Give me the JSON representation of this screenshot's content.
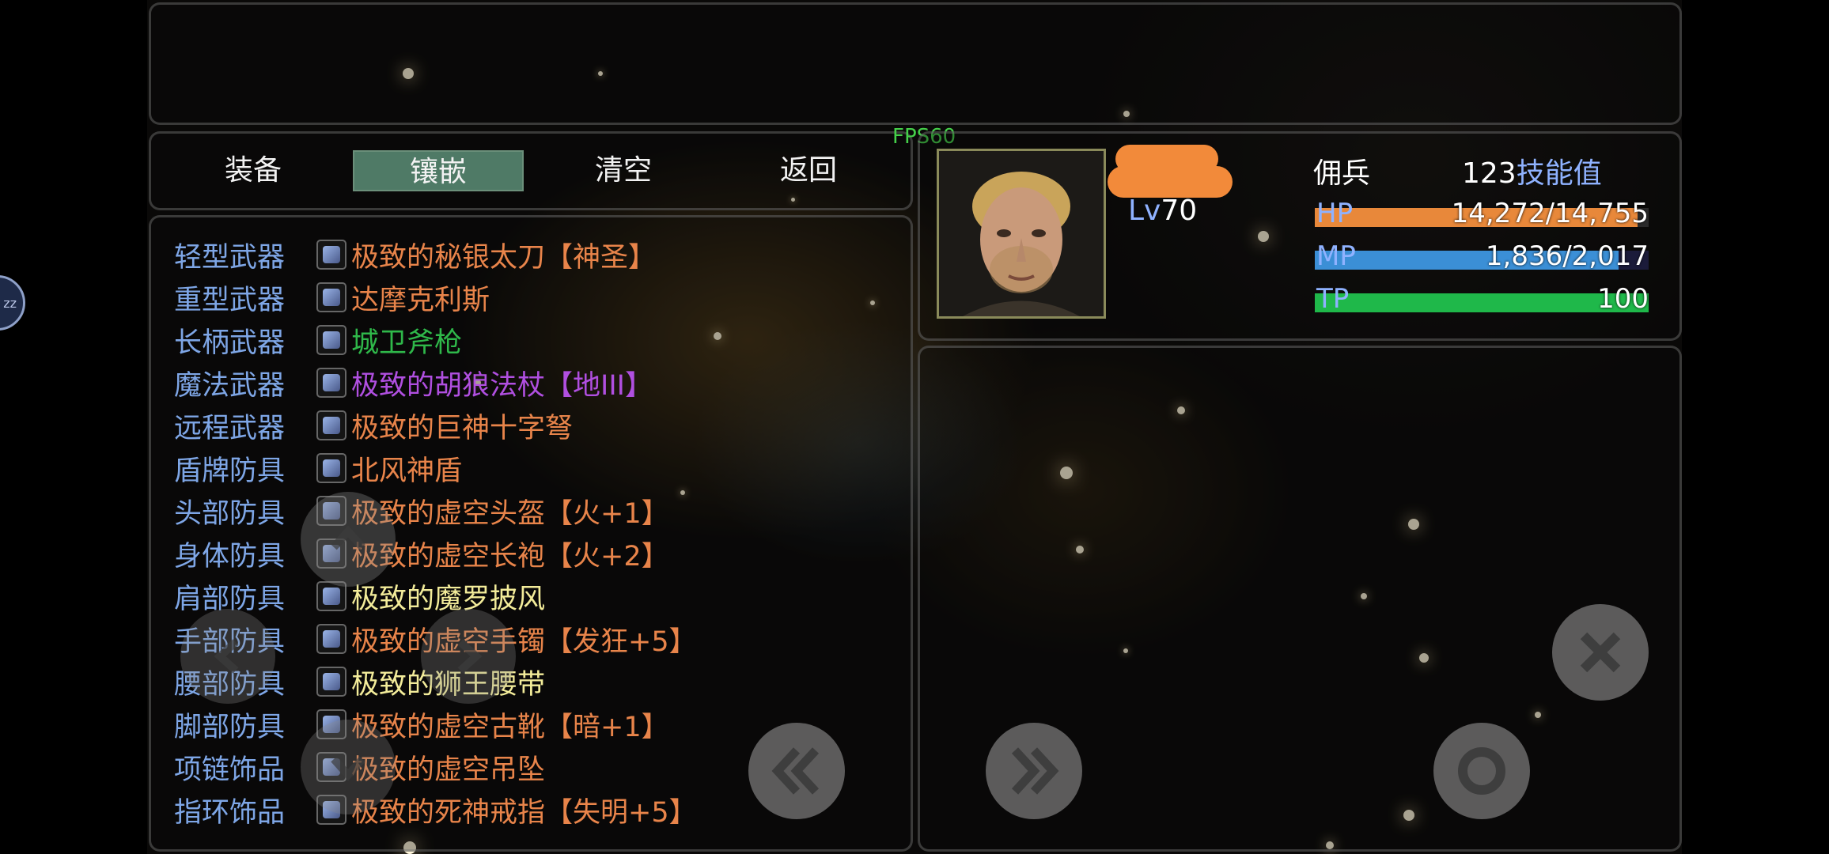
{
  "fps": "FPS60",
  "tabs": [
    {
      "label": "装备",
      "active": false
    },
    {
      "label": "镶嵌",
      "active": true
    },
    {
      "label": "清空",
      "active": false
    },
    {
      "label": "返回",
      "active": false
    }
  ],
  "equipment": [
    {
      "slot": "轻型武器",
      "item": "极致的秘银太刀【神圣】",
      "color": "#e8844a",
      "icon": "blade-icon"
    },
    {
      "slot": "重型武器",
      "item": "达摩克利斯",
      "color": "#e8844a",
      "icon": "greatsword-icon"
    },
    {
      "slot": "长柄武器",
      "item": "城卫斧枪",
      "color": "#2fb84a",
      "icon": "halberd-icon"
    },
    {
      "slot": "魔法武器",
      "item": "极致的胡狼法杖【地III】",
      "color": "#b04fe0",
      "icon": "staff-icon"
    },
    {
      "slot": "远程武器",
      "item": "极致的巨神十字弩",
      "color": "#e8844a",
      "icon": "crossbow-icon"
    },
    {
      "slot": "盾牌防具",
      "item": "北风神盾",
      "color": "#e8844a",
      "icon": "shield-icon"
    },
    {
      "slot": "头部防具",
      "item": "极致的虚空头盔【火+1】",
      "color": "#e8844a",
      "icon": "helmet-icon"
    },
    {
      "slot": "身体防具",
      "item": "极致的虚空长袍【火+2】",
      "color": "#e8844a",
      "icon": "robe-icon"
    },
    {
      "slot": "肩部防具",
      "item": "极致的魔罗披风",
      "color": "#f3ec9a",
      "icon": "cloak-icon"
    },
    {
      "slot": "手部防具",
      "item": "极致的虚空手镯【发狂+5】",
      "color": "#e8844a",
      "icon": "bracelet-icon"
    },
    {
      "slot": "腰部防具",
      "item": "极致的狮王腰带",
      "color": "#f3ec9a",
      "icon": "belt-icon"
    },
    {
      "slot": "脚部防具",
      "item": "极致的虚空古靴【暗+1】",
      "color": "#e8844a",
      "icon": "boots-icon"
    },
    {
      "slot": "项链饰品",
      "item": "极致的虚空吊坠",
      "color": "#e8844a",
      "icon": "pendant-icon"
    },
    {
      "slot": "指环饰品",
      "item": "极致的死神戒指【失明+5】",
      "color": "#e8844a",
      "icon": "ring-icon"
    }
  ],
  "character": {
    "level_prefix": "Lv",
    "level": "70",
    "class": "佣兵",
    "skill_points": "123",
    "skill_label": "技能值",
    "hp": {
      "label": "HP",
      "value": "14,272/14,755",
      "fraction": 0.967,
      "color": "#e8883a"
    },
    "mp": {
      "label": "MP",
      "value": "1,836/2,017",
      "fraction": 0.91,
      "color": "#3b8fd6"
    },
    "tp": {
      "label": "TP",
      "value": "100",
      "fraction": 1.0,
      "color": "#1fb84a"
    }
  },
  "controls": [
    {
      "name": "dpad-up",
      "icon": "chevron-up-icon"
    },
    {
      "name": "dpad-left",
      "icon": "chevron-left-icon"
    },
    {
      "name": "dpad-right",
      "icon": "chevron-right-icon"
    },
    {
      "name": "dpad-down",
      "icon": "chevron-down-icon"
    },
    {
      "name": "page-prev-button",
      "icon": "double-chevron-left-icon"
    },
    {
      "name": "page-next-button",
      "icon": "double-chevron-right-icon"
    },
    {
      "name": "cancel-button",
      "icon": "close-icon"
    },
    {
      "name": "confirm-button",
      "icon": "circle-icon"
    }
  ],
  "side_indicator": "zz"
}
